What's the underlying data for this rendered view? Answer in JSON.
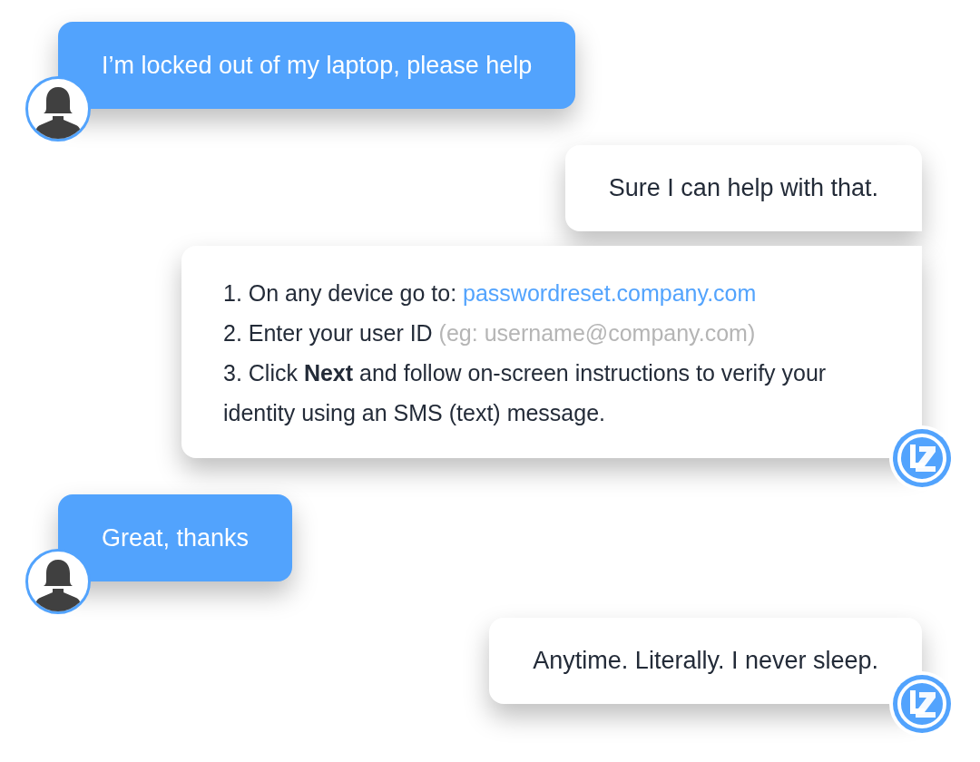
{
  "messages": [
    {
      "kind": "user",
      "avatar": true,
      "text": "I’m locked out of my laptop, please help"
    },
    {
      "kind": "bot",
      "logo": false,
      "text": "Sure I can help with that."
    },
    {
      "kind": "bot_steps",
      "logo": true,
      "steps": [
        {
          "text": "1. On any device go to:",
          "link": "passwordreset.company.com"
        },
        {
          "text": "2. Enter your user ID",
          "hint": "(eg: username@company.com)"
        },
        {
          "text": "3. Click **Next** and follow on-screen instructions to verify your identity using an SMS (text) message."
        }
      ]
    },
    {
      "kind": "user",
      "avatar": true,
      "text": "Great, thanks"
    },
    {
      "kind": "bot",
      "logo": true,
      "text": "Anytime. Literally. I never sleep."
    }
  ]
}
